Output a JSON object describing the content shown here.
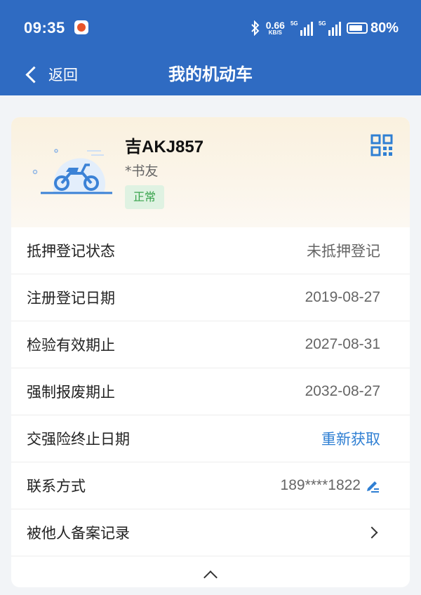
{
  "status_bar": {
    "time": "09:35",
    "speed_value": "0.66",
    "speed_unit": "KB/S",
    "signal1_label": "5G",
    "signal2_label": "5G",
    "battery_level": 0.8,
    "battery_text": "80%",
    "icons": [
      "app-notification-icon",
      "bluetooth-icon",
      "signal-icon",
      "battery-icon"
    ]
  },
  "nav": {
    "back_label": "返回",
    "title": "我的机动车"
  },
  "vehicle": {
    "plate": "吉AKJ857",
    "owner": "*书友",
    "status": "正常",
    "status_color": "#38a34c",
    "accent_color": "#2f7fd3"
  },
  "rows": [
    {
      "label": "抵押登记状态",
      "value": "未抵押登记"
    },
    {
      "label": "注册登记日期",
      "value": "2019-08-27"
    },
    {
      "label": "检验有效期止",
      "value": "2027-08-31"
    },
    {
      "label": "强制报废期止",
      "value": "2032-08-27"
    },
    {
      "label": "交强险终止日期",
      "value": "重新获取"
    },
    {
      "label": "联系方式",
      "value": "189****1822"
    },
    {
      "label": "被他人备案记录",
      "value": ""
    }
  ]
}
